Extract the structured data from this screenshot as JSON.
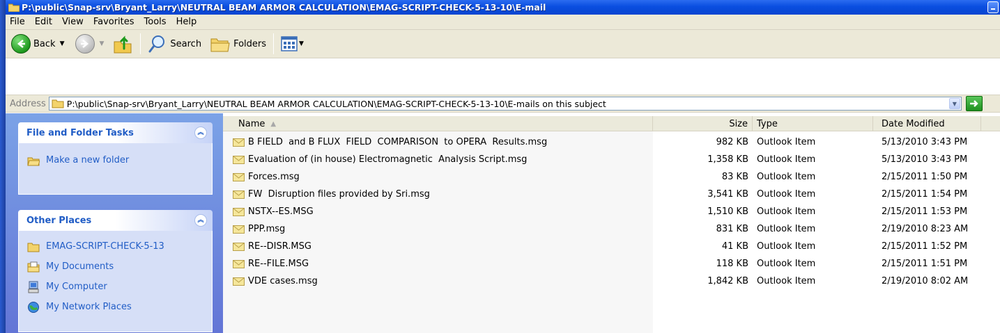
{
  "window": {
    "title": "P:\\public\\Snap-srv\\Bryant_Larry\\NEUTRAL BEAM ARMOR CALCULATION\\EMAG-SCRIPT-CHECK-5-13-10\\E-mail"
  },
  "menu": [
    "File",
    "Edit",
    "View",
    "Favorites",
    "Tools",
    "Help"
  ],
  "toolbar": {
    "back_label": "Back",
    "search_label": "Search",
    "folders_label": "Folders"
  },
  "address": {
    "label": "Address",
    "path": "P:\\public\\Snap-srv\\Bryant_Larry\\NEUTRAL BEAM ARMOR CALCULATION\\EMAG-SCRIPT-CHECK-5-13-10\\E-mails on this subject"
  },
  "tasks": {
    "title": "File and Folder Tasks",
    "items": [
      {
        "label": "Make a new folder",
        "icon": "new-folder-icon"
      }
    ]
  },
  "places": {
    "title": "Other Places",
    "items": [
      {
        "label": "EMAG-SCRIPT-CHECK-5-13",
        "icon": "folder-icon"
      },
      {
        "label": "My Documents",
        "icon": "my-documents-icon"
      },
      {
        "label": "My Computer",
        "icon": "my-computer-icon"
      },
      {
        "label": "My Network Places",
        "icon": "network-places-icon"
      }
    ]
  },
  "columns": {
    "name": "Name",
    "size": "Size",
    "type": "Type",
    "date": "Date Modified",
    "sort_indicator": "▲"
  },
  "files": [
    {
      "name": "B FIELD  and B FLUX  FIELD  COMPARISON  to OPERA  Results.msg",
      "size": "982 KB",
      "type": "Outlook Item",
      "date": "5/13/2010 3:43 PM"
    },
    {
      "name": "Evaluation of (in house) Electromagnetic  Analysis Script.msg",
      "size": "1,358 KB",
      "type": "Outlook Item",
      "date": "5/13/2010 3:43 PM"
    },
    {
      "name": "Forces.msg",
      "size": "83 KB",
      "type": "Outlook Item",
      "date": "2/15/2011 1:50 PM"
    },
    {
      "name": "FW  Disruption files provided by Sri.msg",
      "size": "3,541 KB",
      "type": "Outlook Item",
      "date": "2/15/2011 1:54 PM"
    },
    {
      "name": "NSTX--ES.MSG",
      "size": "1,510 KB",
      "type": "Outlook Item",
      "date": "2/15/2011 1:53 PM"
    },
    {
      "name": "PPP.msg",
      "size": "831 KB",
      "type": "Outlook Item",
      "date": "2/19/2010 8:23 AM"
    },
    {
      "name": "RE--DISR.MSG",
      "size": "41 KB",
      "type": "Outlook Item",
      "date": "2/15/2011 1:52 PM"
    },
    {
      "name": "RE--FILE.MSG",
      "size": "118 KB",
      "type": "Outlook Item",
      "date": "2/15/2011 1:51 PM"
    },
    {
      "name": "VDE cases.msg",
      "size": "1,842 KB",
      "type": "Outlook Item",
      "date": "2/19/2010 8:02 AM"
    }
  ]
}
